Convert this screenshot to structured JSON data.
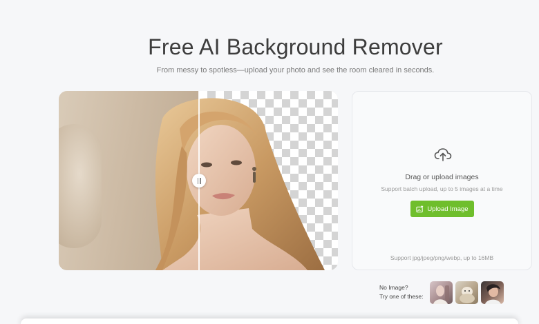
{
  "header": {
    "title": "Free AI Background Remover",
    "subtitle": "From messy to spotless—upload your photo and see the room cleared in seconds."
  },
  "compare": {
    "handle_icon": "drag-handle-icon"
  },
  "upload": {
    "icon": "cloud-upload-icon",
    "title": "Drag or upload images",
    "note": "Support batch upload, up to 5 images at a time",
    "button_label": "Upload Image",
    "button_icon": "image-upload-icon",
    "formats": "Support jpg/jpeg/png/webp, up to 16MB",
    "accent": "#6fbe2c"
  },
  "samples": {
    "label_line1": "No Image?",
    "label_line2": "Try one of these:"
  }
}
